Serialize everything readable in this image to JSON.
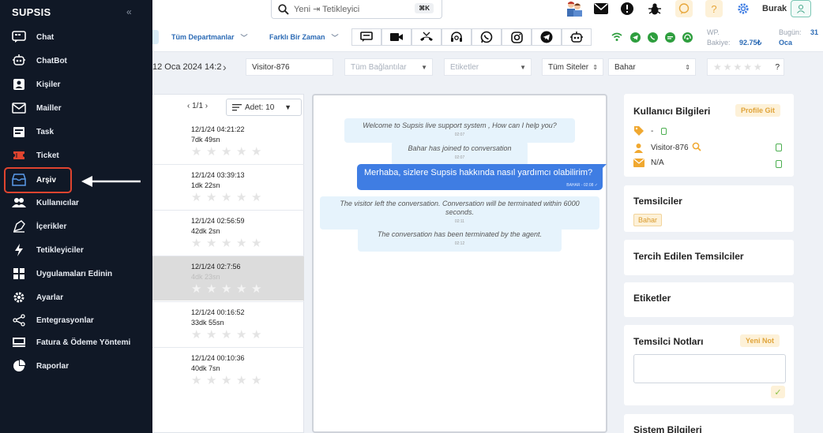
{
  "sidebar": {
    "brand": "SUPSIS",
    "collapse_glyph": "«",
    "items": [
      {
        "label": "Chat",
        "icon": "chat-icon"
      },
      {
        "label": "ChatBot",
        "icon": "chatbot-icon"
      },
      {
        "label": "Kişiler",
        "icon": "contacts-icon"
      },
      {
        "label": "Mailler",
        "icon": "mail-icon"
      },
      {
        "label": "Task",
        "icon": "task-icon"
      },
      {
        "label": "Ticket",
        "icon": "ticket-icon"
      },
      {
        "label": "Arşiv",
        "icon": "archive-icon",
        "active": true
      },
      {
        "label": "Kullanıcılar",
        "icon": "users-icon"
      },
      {
        "label": "İçerikler",
        "icon": "content-icon"
      },
      {
        "label": "Tetikleyiciler",
        "icon": "trigger-icon"
      },
      {
        "label": "Uygulamaları Edinin",
        "icon": "apps-icon"
      },
      {
        "label": "Ayarlar",
        "icon": "settings-icon"
      },
      {
        "label": "Entegrasyonlar",
        "icon": "integrations-icon"
      },
      {
        "label": "Fatura & Ödeme Yöntemi",
        "icon": "billing-icon"
      },
      {
        "label": "Raporlar",
        "icon": "reports-icon"
      }
    ]
  },
  "topbar": {
    "search_placeholder": "Yeni ⇥ Tetikleyici",
    "shortcut": "⌘K",
    "user_name": "Burak",
    "departments": "Tüm Departmanlar",
    "time_filter": "Farklı Bir Zaman",
    "stats": {
      "wp_label": "WP.",
      "balance_label": "Bakiye:",
      "balance_value": "92.75₺",
      "today_label": "Bugün:",
      "today_value": "31",
      "month_value": "Oca"
    }
  },
  "filters": {
    "date": "12 Oca 2024 14:2",
    "visitor": "Visitor-876",
    "connections": "Tüm Bağlantılar",
    "tags": "Etiketler",
    "sites": "Tüm Siteler",
    "agent": "Bahar",
    "rating_suffix": "?"
  },
  "conversation_list": {
    "pager": "‹ 1/1 ›",
    "per_page": "Adet: 10",
    "rows": [
      {
        "date": "12/1/24 04:21:22",
        "duration": "7dk 49sn"
      },
      {
        "date": "12/1/24 03:39:13",
        "duration": "1dk 22sn"
      },
      {
        "date": "12/1/24 02:56:59",
        "duration": "42dk 2sn"
      },
      {
        "date": "12/1/24 02:7:56",
        "duration": "4dk 23sn",
        "selected": true
      },
      {
        "date": "12/1/24 00:16:52",
        "duration": "33dk 55sn"
      },
      {
        "date": "12/1/24 00:10:36",
        "duration": "40dk 7sn"
      }
    ]
  },
  "chat": {
    "messages": [
      {
        "type": "system",
        "text": "Welcome to Supsis live support system , How can I help you?",
        "time": "02:07"
      },
      {
        "type": "system",
        "text": "Bahar has joined to conversation",
        "time": "02:07"
      },
      {
        "type": "agent",
        "text": "Merhaba, sizlere Supsis hakkında nasıl yardımcı olabilirim?",
        "meta": "BAHAR - 02:08 ✓"
      },
      {
        "type": "system",
        "text": "The visitor left the conversation. Conversation will be terminated within 6000 seconds.",
        "time": "02:11"
      },
      {
        "type": "system",
        "text": "The conversation has been terminated by the agent.",
        "time": "02:12"
      }
    ]
  },
  "right_panel": {
    "user_info_title": "Kullanıcı Bilgileri",
    "profile_button": "Profile Git",
    "tag_value": "-",
    "visitor_name": "Visitor-876",
    "email_value": "N/A",
    "agents_title": "Temsilciler",
    "agent_chip": "Bahar",
    "preferred_title": "Tercih Edilen Temsilciler",
    "labels_title": "Etiketler",
    "notes_title": "Temsilci Notları",
    "new_note_button": "Yeni Not",
    "system_info_title": "Sistem Bilgileri"
  },
  "colors": {
    "sidebar_bg": "#101826",
    "accent_blue": "#3f7de3",
    "highlight_red": "#e0442f",
    "warning_bg": "#fdf1d8"
  }
}
